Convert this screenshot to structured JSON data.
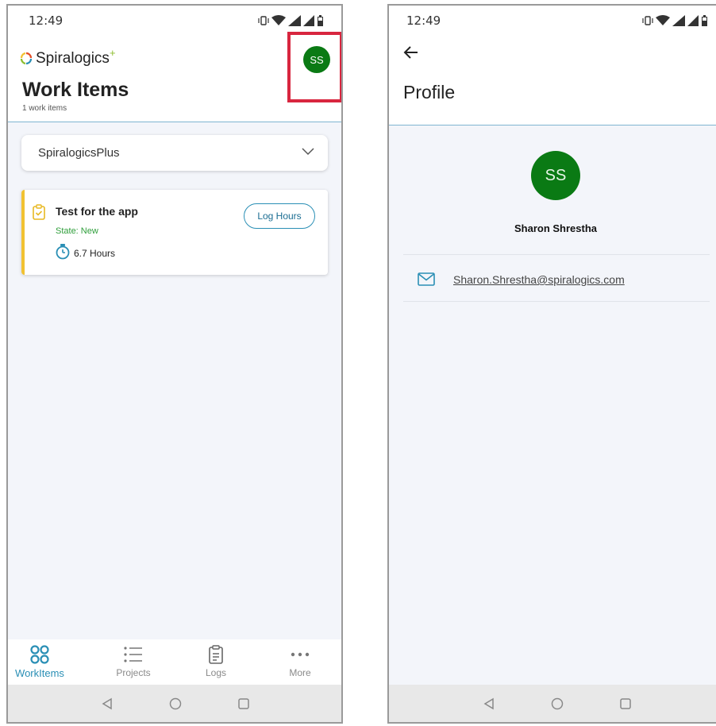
{
  "left_screen": {
    "status_time": "12:49",
    "brand_name": "Spiralogics",
    "brand_plus": "+",
    "title": "Work Items",
    "subtitle": "1 work items",
    "avatar_initials": "SS",
    "project_select": "SpiralogicsPlus",
    "work_item": {
      "title": "Test for the app",
      "state": "State: New",
      "hours": "6.7 Hours",
      "action_label": "Log Hours"
    },
    "nav": [
      {
        "label": "WorkItems",
        "icon": "workitems-icon",
        "active": true
      },
      {
        "label": "Projects",
        "icon": "list-icon",
        "active": false
      },
      {
        "label": "Logs",
        "icon": "clipboard-icon",
        "active": false
      },
      {
        "label": "More",
        "icon": "more-dots-icon",
        "active": false
      }
    ]
  },
  "right_screen": {
    "status_time": "12:49",
    "title": "Profile",
    "avatar_initials": "SS",
    "name": "Sharon Shrestha",
    "email": "Sharon.Shrestha@spiralogics.com"
  },
  "colors": {
    "avatar_green": "#0a7a14",
    "accent_blue": "#2a8fb5",
    "highlight_red": "#d8263f",
    "card_border_yellow": "#f1c232",
    "state_green": "#2e9e3a"
  }
}
